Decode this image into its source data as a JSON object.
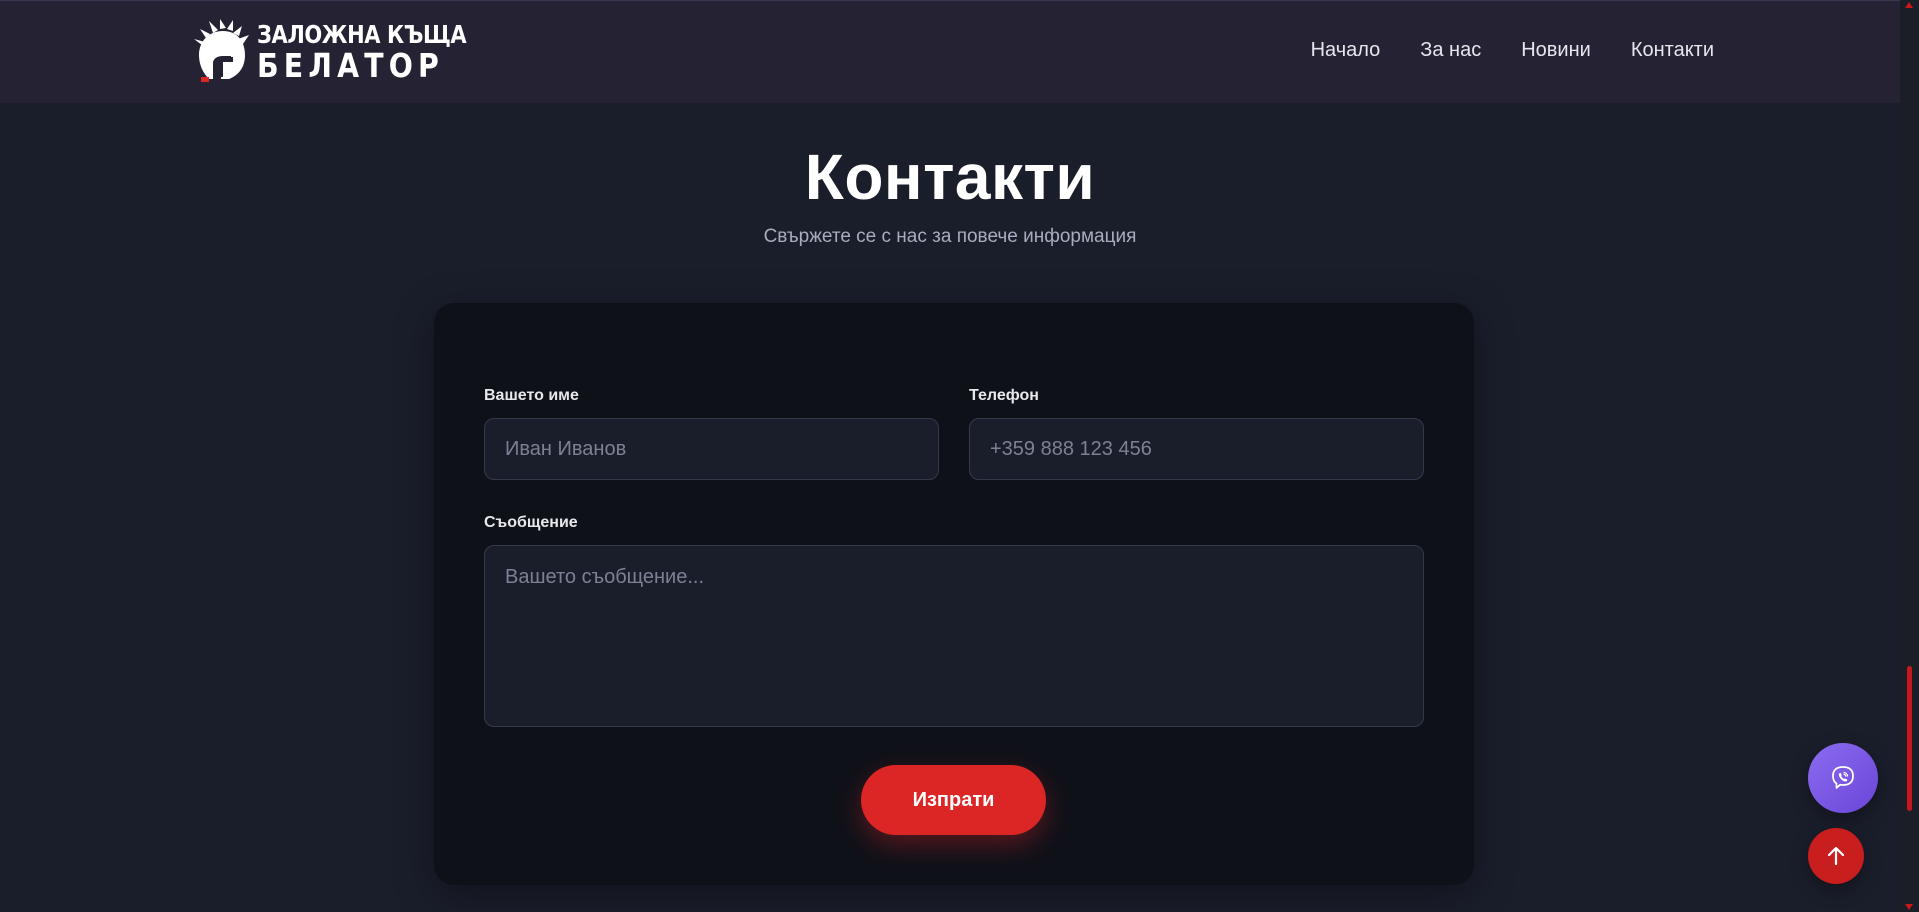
{
  "header": {
    "logo": {
      "line1": "ЗАЛОЖНА КЪЩА",
      "line2": "БЕЛАТОР",
      "icon": "spartan-helmet-icon"
    },
    "nav": [
      {
        "label": "Начало"
      },
      {
        "label": "За нас"
      },
      {
        "label": "Новини"
      },
      {
        "label": "Контакти"
      }
    ]
  },
  "page": {
    "title": "Контакти",
    "subtitle": "Свържете се с нас за повече информация"
  },
  "form": {
    "name": {
      "label": "Вашето име",
      "placeholder": "Иван Иванов",
      "value": ""
    },
    "phone": {
      "label": "Телефон",
      "placeholder": "+359 888 123 456",
      "value": ""
    },
    "message": {
      "label": "Съобщение",
      "placeholder": "Вашето съобщение...",
      "value": ""
    },
    "submit_label": "Изпрати"
  },
  "floating": {
    "viber_icon": "viber-icon",
    "scroll_top_icon": "arrow-up-icon"
  },
  "colors": {
    "background": "#1a1e2b",
    "header": "#242233",
    "card": "#0f1119",
    "accent": "#dc2626",
    "viber": "#7b5ce6"
  }
}
